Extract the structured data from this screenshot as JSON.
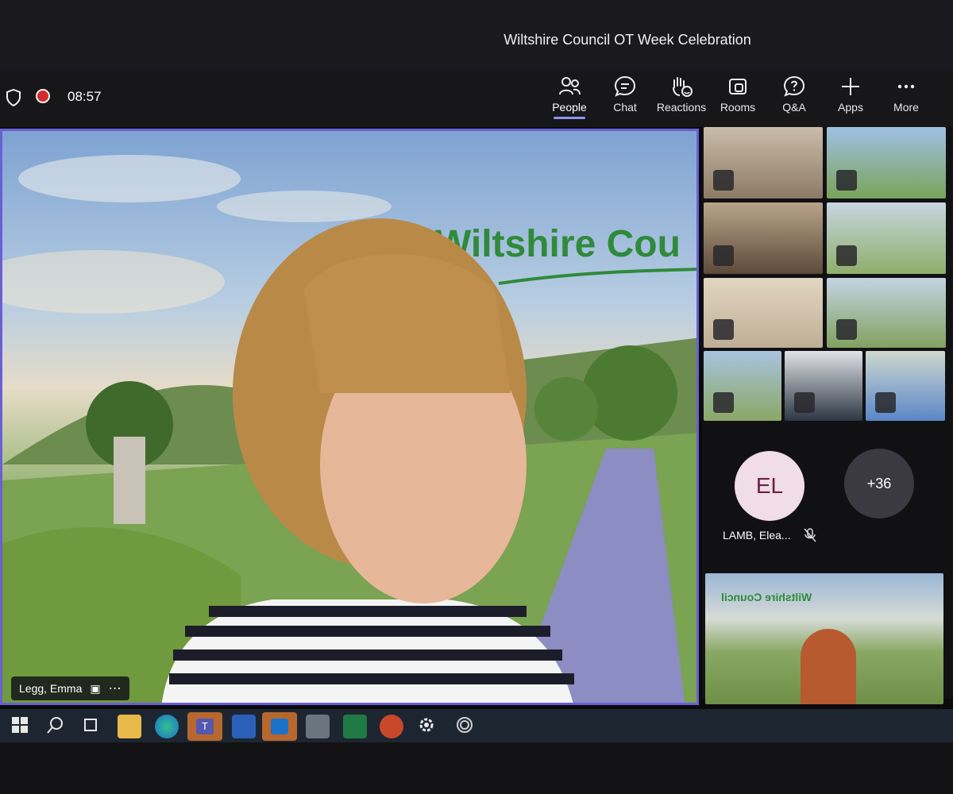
{
  "window": {
    "title": "Wiltshire Council OT Week Celebration"
  },
  "call": {
    "timer": "08:57"
  },
  "toolbar": {
    "buttons": [
      {
        "label": "People",
        "icon": "people-icon"
      },
      {
        "label": "Chat",
        "icon": "chat-icon"
      },
      {
        "label": "Reactions",
        "icon": "reactions-icon"
      },
      {
        "label": "Rooms",
        "icon": "rooms-icon"
      },
      {
        "label": "Q&A",
        "icon": "qa-icon"
      },
      {
        "label": "Apps",
        "icon": "plus-icon"
      },
      {
        "label": "More",
        "icon": "more-icon"
      }
    ]
  },
  "stage": {
    "speaker_name": "Legg, Emma",
    "background_logo_text": "Wiltshire Cou"
  },
  "participants": {
    "avatar_initials": "EL",
    "avatar_name": "LAMB, Elea...",
    "overflow_count": "+36",
    "bottom_tile_logo": "Wiltshire Council"
  },
  "colors": {
    "accent": "#6a5fd6",
    "record": "#d42b2b",
    "wiltshire_green": "#2f8a3a"
  }
}
